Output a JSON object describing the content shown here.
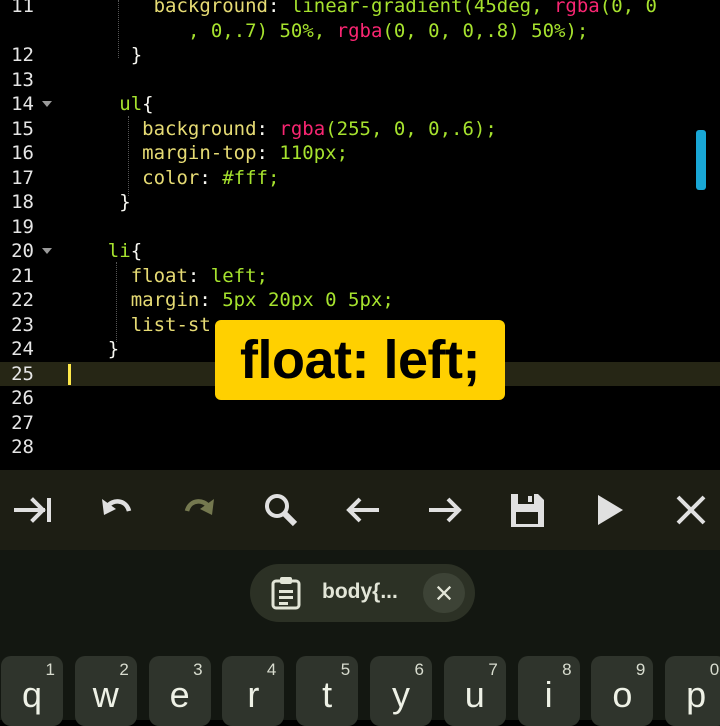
{
  "editor": {
    "lines": [
      {
        "n": "11",
        "indent": 8,
        "fold": false,
        "tokens": [
          {
            "t": "background",
            "c": "prop"
          },
          {
            "t": ": ",
            "c": "punc"
          },
          {
            "t": "linear-gradient(45deg, ",
            "c": "val"
          },
          {
            "t": "rgba",
            "c": "fn"
          },
          {
            "t": "(0, 0",
            "c": "val"
          }
        ]
      },
      {
        "n": "",
        "indent": 11,
        "fold": false,
        "tokens": [
          {
            "t": ", 0,.7) 50%, ",
            "c": "val"
          },
          {
            "t": "rgba",
            "c": "fn"
          },
          {
            "t": "(0, 0, 0,.8) 50%);",
            "c": "val"
          }
        ]
      },
      {
        "n": "12",
        "indent": 6,
        "fold": false,
        "tokens": [
          {
            "t": "}",
            "c": "punc"
          }
        ]
      },
      {
        "n": "13",
        "indent": 0,
        "fold": false,
        "tokens": []
      },
      {
        "n": "14",
        "indent": 5,
        "fold": true,
        "tokens": [
          {
            "t": "ul",
            "c": "sel"
          },
          {
            "t": "{",
            "c": "punc"
          }
        ]
      },
      {
        "n": "15",
        "indent": 7,
        "fold": false,
        "tokens": [
          {
            "t": "background",
            "c": "prop"
          },
          {
            "t": ": ",
            "c": "punc"
          },
          {
            "t": "rgba",
            "c": "fn"
          },
          {
            "t": "(255, 0, 0,.6);",
            "c": "val"
          }
        ]
      },
      {
        "n": "16",
        "indent": 7,
        "fold": false,
        "tokens": [
          {
            "t": "margin-top",
            "c": "prop"
          },
          {
            "t": ": ",
            "c": "punc"
          },
          {
            "t": "110px;",
            "c": "val"
          }
        ]
      },
      {
        "n": "17",
        "indent": 7,
        "fold": false,
        "tokens": [
          {
            "t": "color",
            "c": "prop"
          },
          {
            "t": ": ",
            "c": "punc"
          },
          {
            "t": "#fff;",
            "c": "val"
          }
        ]
      },
      {
        "n": "18",
        "indent": 5,
        "fold": false,
        "tokens": [
          {
            "t": "}",
            "c": "punc"
          }
        ]
      },
      {
        "n": "19",
        "indent": 0,
        "fold": false,
        "tokens": []
      },
      {
        "n": "20",
        "indent": 4,
        "fold": true,
        "tokens": [
          {
            "t": "li",
            "c": "sel"
          },
          {
            "t": "{",
            "c": "punc"
          }
        ]
      },
      {
        "n": "21",
        "indent": 6,
        "fold": false,
        "tokens": [
          {
            "t": "float",
            "c": "prop"
          },
          {
            "t": ": ",
            "c": "punc"
          },
          {
            "t": "left;",
            "c": "val"
          }
        ]
      },
      {
        "n": "22",
        "indent": 6,
        "fold": false,
        "tokens": [
          {
            "t": "margin",
            "c": "prop"
          },
          {
            "t": ": ",
            "c": "punc"
          },
          {
            "t": "5px 20px 0 5px;",
            "c": "val"
          }
        ]
      },
      {
        "n": "23",
        "indent": 6,
        "fold": false,
        "tokens": [
          {
            "t": "list-st",
            "c": "prop"
          }
        ]
      },
      {
        "n": "24",
        "indent": 4,
        "fold": false,
        "tokens": [
          {
            "t": "}",
            "c": "punc"
          }
        ]
      },
      {
        "n": "25",
        "indent": 0,
        "fold": false,
        "tokens": [],
        "current": true
      },
      {
        "n": "26",
        "indent": 0,
        "fold": false,
        "tokens": []
      },
      {
        "n": "27",
        "indent": 0,
        "fold": false,
        "tokens": []
      },
      {
        "n": "28",
        "indent": 0,
        "fold": false,
        "tokens": []
      }
    ]
  },
  "overlay": {
    "caption": "float: left;"
  },
  "toolbar": {
    "buttons": [
      {
        "name": "tab-indent-icon"
      },
      {
        "name": "undo-icon"
      },
      {
        "name": "redo-icon"
      },
      {
        "name": "search-icon"
      },
      {
        "name": "arrow-left-icon"
      },
      {
        "name": "arrow-right-icon"
      },
      {
        "name": "save-icon"
      },
      {
        "name": "run-icon"
      },
      {
        "name": "close-icon"
      }
    ]
  },
  "keyboard": {
    "clipboard_suggestion": "body{...",
    "keys": [
      {
        "letter": "q",
        "num": "1"
      },
      {
        "letter": "w",
        "num": "2"
      },
      {
        "letter": "e",
        "num": "3"
      },
      {
        "letter": "r",
        "num": "4"
      },
      {
        "letter": "t",
        "num": "5"
      },
      {
        "letter": "y",
        "num": "6"
      },
      {
        "letter": "u",
        "num": "7"
      },
      {
        "letter": "i",
        "num": "8"
      },
      {
        "letter": "o",
        "num": "9"
      },
      {
        "letter": "p",
        "num": "0"
      }
    ]
  },
  "colors": {
    "accent": "#ffd000",
    "scroll": "#19a7d6",
    "property": "#e6db74",
    "value": "#a6e22e",
    "function": "#f92672"
  }
}
